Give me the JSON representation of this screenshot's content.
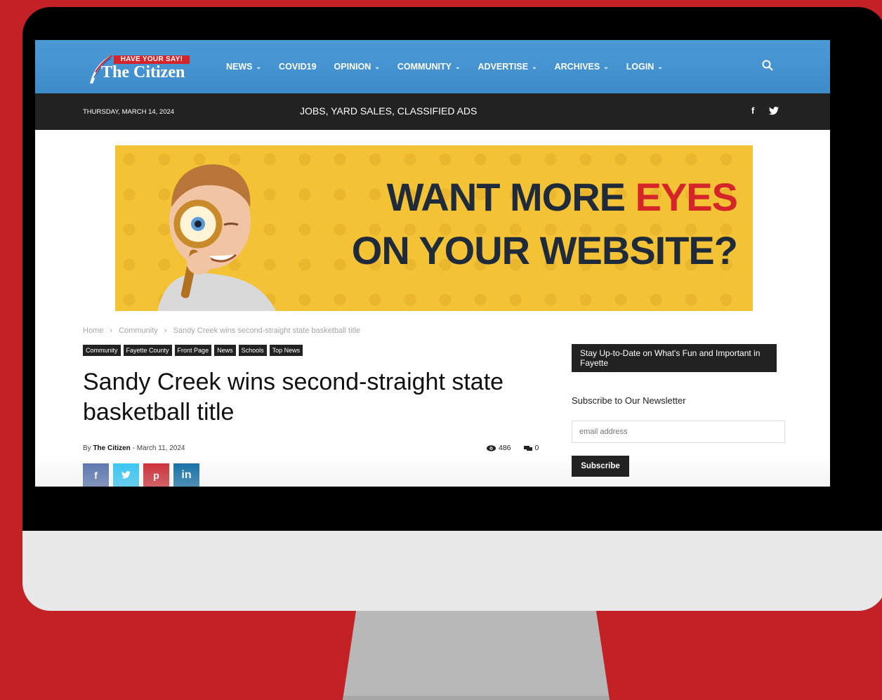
{
  "site": {
    "tagline": "HAVE YOUR SAY!",
    "name": "The Citizen"
  },
  "nav": {
    "items": [
      {
        "label": "NEWS",
        "has_menu": true
      },
      {
        "label": "COVID19",
        "has_menu": false
      },
      {
        "label": "OPINION",
        "has_menu": true
      },
      {
        "label": "COMMUNITY",
        "has_menu": true
      },
      {
        "label": "ADVERTISE",
        "has_menu": true
      },
      {
        "label": "ARCHIVES",
        "has_menu": true
      },
      {
        "label": "LOGIN",
        "has_menu": true
      }
    ],
    "search_icon": "search-icon"
  },
  "subbar": {
    "date": "THURSDAY, MARCH 14, 2024",
    "jobs_link": "JOBS, YARD SALES, CLASSIFIED ADS",
    "facebook": "f"
  },
  "banner": {
    "line1_a": "WANT MORE ",
    "line1_b": "EYES",
    "line2": "ON YOUR WEBSITE?"
  },
  "article": {
    "breadcrumb": [
      "Home",
      "›",
      "Community",
      "›",
      "Sandy Creek wins second-straight state basketball title"
    ],
    "categories": [
      "Community",
      "Fayette County",
      "Front Page",
      "News",
      "Schools",
      "Top News"
    ],
    "title": "Sandy Creek wins second-straight state basketball title",
    "by": "By",
    "author": "The Citizen",
    "dash": "-",
    "date": "March 11, 2024",
    "views": "486",
    "comments": "0",
    "share": {
      "facebook": "f",
      "pinterest": "p",
      "linkedin": "in"
    }
  },
  "sidebar": {
    "header": "Stay Up-to-Date on What's Fun and Important in Fayette",
    "subheader": "Subscribe to Our Newsletter",
    "email_placeholder": "email address",
    "subscribe_label": "Subscribe"
  },
  "colors": {
    "background": "#c42127",
    "nav": "#4b9ad6",
    "banner": "#f4c235",
    "accent_red": "#d6242b"
  }
}
